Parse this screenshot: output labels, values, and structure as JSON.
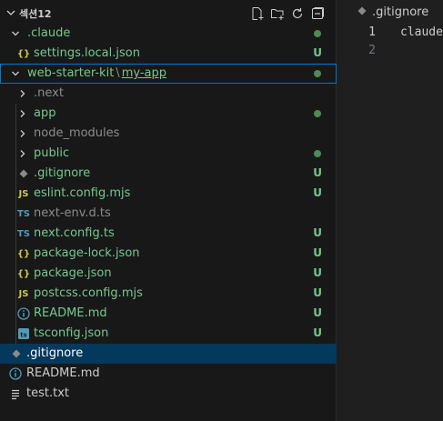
{
  "explorer": {
    "section_title": "섹션12",
    "actions": [
      "new-file-icon",
      "new-folder-icon",
      "refresh-icon",
      "collapse-all-icon"
    ],
    "items": [
      {
        "label": ".claude",
        "badge": "",
        "dot": true
      },
      {
        "label": "settings.local.json",
        "badge": "U",
        "dot": false
      },
      {
        "label_a": "web-starter-kit",
        "sep": "\\",
        "label_b": "my-app",
        "badge": "",
        "dot": true
      },
      {
        "label": ".next",
        "badge": "",
        "dot": false
      },
      {
        "label": "app",
        "badge": "",
        "dot": true
      },
      {
        "label": "node_modules",
        "badge": "",
        "dot": false
      },
      {
        "label": "public",
        "badge": "",
        "dot": true
      },
      {
        "label": ".gitignore",
        "badge": "U",
        "dot": false
      },
      {
        "label": "eslint.config.mjs",
        "badge": "U",
        "dot": false
      },
      {
        "label": "next-env.d.ts",
        "badge": "",
        "dot": false
      },
      {
        "label": "next.config.ts",
        "badge": "U",
        "dot": false
      },
      {
        "label": "package-lock.json",
        "badge": "U",
        "dot": false
      },
      {
        "label": "package.json",
        "badge": "U",
        "dot": false
      },
      {
        "label": "postcss.config.mjs",
        "badge": "U",
        "dot": false
      },
      {
        "label": "README.md",
        "badge": "U",
        "dot": false
      },
      {
        "label": "tsconfig.json",
        "badge": "U",
        "dot": false
      },
      {
        "label": ".gitignore",
        "badge": "",
        "dot": false
      },
      {
        "label": "README.md",
        "badge": "",
        "dot": false
      },
      {
        "label": "test.txt",
        "badge": "",
        "dot": false
      }
    ],
    "icons": {
      "json": "{}",
      "js": "JS",
      "ts": "TS"
    }
  },
  "editor": {
    "tab_label": ".gitignore",
    "lines": [
      {
        "number": "1",
        "text": "claude"
      },
      {
        "number": "2",
        "text": ""
      }
    ]
  },
  "colors": {
    "accent": "#0078d4",
    "untracked": "#73c991",
    "selected_bg": "#04395e",
    "json_icon": "#cbcb41",
    "js_icon": "#cbcb41",
    "ts_icon": "#519aba"
  }
}
